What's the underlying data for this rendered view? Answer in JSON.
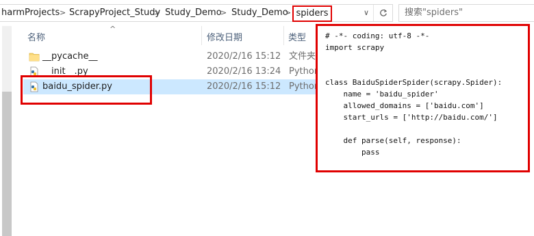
{
  "address_bar": {
    "crumbs": [
      "harmProjects",
      "ScrapyProject_Study",
      "Study_Demo",
      "Study_Demo"
    ],
    "current": "spiders",
    "separator": ">",
    "dropdown_glyph": "∨"
  },
  "search": {
    "placeholder": "搜索\"spiders\""
  },
  "columns": {
    "name": "名称",
    "date": "修改日期",
    "type": "类型",
    "sort_glyph": "^"
  },
  "files": [
    {
      "name": "__pycache__",
      "date": "2020/2/16 15:12",
      "type": "文件夹",
      "icon": "folder-icon"
    },
    {
      "name": "__init__.py",
      "date": "2020/2/16 13:24",
      "type": "Python",
      "icon": "python-file-icon"
    },
    {
      "name": "baidu_spider.py",
      "date": "2020/2/16 15:12",
      "type": "Python",
      "icon": "python-file-icon",
      "selected": true
    }
  ],
  "code_lines": [
    "# -*- coding: utf-8 -*-",
    "import scrapy",
    "",
    "",
    "class BaiduSpiderSpider(scrapy.Spider):",
    "    name = 'baidu_spider'",
    "    allowed_domains = ['baidu.com']",
    "    start_urls = ['http://baidu.com/']",
    "",
    "    def parse(self, response):",
    "        pass"
  ],
  "colors": {
    "highlight_border": "#e00000",
    "selection": "#cce8ff",
    "header_text": "#4c607a"
  }
}
